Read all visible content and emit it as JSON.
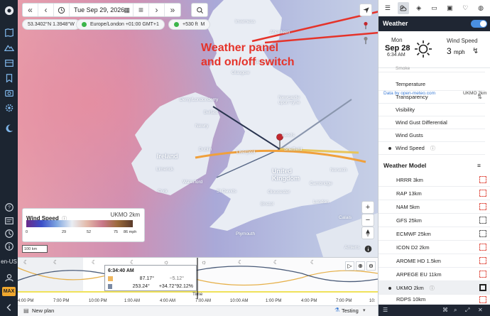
{
  "toolbar": {
    "date": "Tue Sep 29, 2026"
  },
  "chips": {
    "coords": "53.3402°N 1.3948°W",
    "timezone": "Europe/London +01:00 GMT+1",
    "elevation": "+530 ft",
    "extra": "M"
  },
  "map_labels": {
    "inverness": "Inverness",
    "aberdeen": "Aberdeen",
    "dundee": "Dundee",
    "edinburgh": "Edinburgh",
    "glasgow": "Glasgow",
    "newcastle": "Newcastle upon Tyne",
    "derry": "Derry/Londonderry",
    "belfast": "Belfast",
    "newry": "Newry",
    "ireland": "Ireland",
    "dublin": "Dublin",
    "limerick": "Limerick",
    "waterford": "Waterford",
    "cork": "Cork",
    "leeds": "Leeds",
    "sheffield": "Sheffield",
    "liverpool": "Liverpool",
    "uk": "United Kingdom",
    "norwich": "Norwich",
    "cambridge": "Cambridge",
    "gloucester": "Gloucester",
    "stdavids": "St Davids",
    "bristol": "Bristol",
    "london": "London",
    "calais": "Calais",
    "plymouth": "Plymouth",
    "amiens": "Amiens",
    "rennes": "Rennes"
  },
  "legend": {
    "title": "Wind Speed",
    "model": "UKMO 2km",
    "ticks": [
      "0",
      "29",
      "52",
      "75",
      "86 mph"
    ]
  },
  "scale_label": "100 km",
  "annotation": {
    "line1": "Weather panel",
    "line2": "and on/off switch"
  },
  "timeline": {
    "time": "6:34:40 AM",
    "row1_a": "87.17°",
    "row1_b": "−5.12°",
    "row2_a": "253.24°",
    "row2_b": "+34.72°",
    "row2_c": "92.12%",
    "axis_label": "Time",
    "ticks": [
      "4:00 PM",
      "7:00 PM",
      "10:00 PM",
      "1:00 AM",
      "4:00 AM",
      "7:00 AM",
      "10:00 AM",
      "1:00 PM",
      "4:00 PM",
      "7:00 PM",
      "10:"
    ]
  },
  "bottom": {
    "new_plan": "New plan",
    "testing": "Testing"
  },
  "rail": {
    "lang": "en-US",
    "badge": "MAX"
  },
  "panel": {
    "title": "Weather",
    "day": "Mon",
    "date": "Sep 28",
    "time": "6:34 AM",
    "wind_label": "Wind Speed",
    "wind_value": "3",
    "wind_unit": "mph",
    "source": "Data by open-meteo.com",
    "model_short": "UKMO 2km",
    "variables": [
      "Smoke",
      "Temperature",
      "Transparency",
      "Visibility",
      "Wind Gust Differential",
      "Wind Gusts",
      "Wind Speed"
    ],
    "model_header": "Weather Model",
    "models": [
      "HRRR 3km",
      "RAP 13km",
      "NAM 5km",
      "GFS 25km",
      "ECMWF 25km",
      "ICON D2 2km",
      "AROME HD 1.5km",
      "ARPEGE EU 11km",
      "UKMO 2km",
      "RDPS 10km"
    ]
  }
}
